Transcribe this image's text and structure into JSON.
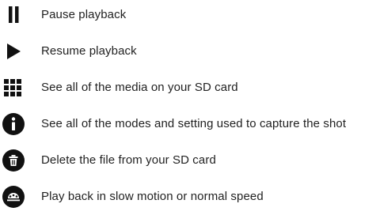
{
  "legend": {
    "items": [
      {
        "icon": "pause-icon",
        "label": "Pause playback"
      },
      {
        "icon": "play-icon",
        "label": "Resume playback"
      },
      {
        "icon": "grid-icon",
        "label": "See all of the media on your SD card"
      },
      {
        "icon": "info-icon",
        "label": "See all of the modes and setting used to capture the shot"
      },
      {
        "icon": "trash-icon",
        "label": "Delete the file from your SD card"
      },
      {
        "icon": "slow-motion-icon",
        "label": "Play back in slow motion or normal speed"
      }
    ]
  },
  "colors": {
    "icon": "#111111",
    "text": "#222222",
    "background": "#ffffff"
  }
}
